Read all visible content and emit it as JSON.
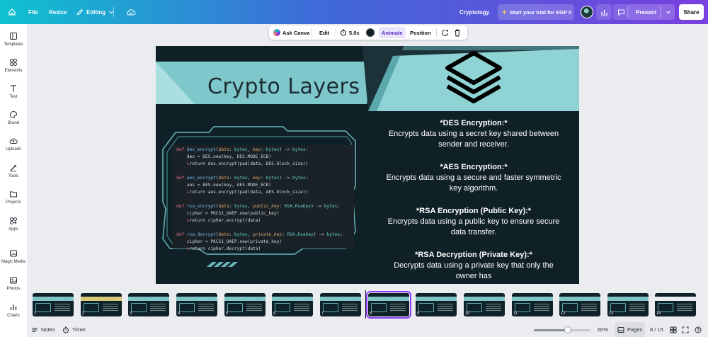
{
  "topbar": {
    "file": "File",
    "resize": "Resize",
    "editing": "Editing",
    "title": "Cryptology",
    "trial": "Start your trial for EGP 0",
    "present": "Present",
    "share": "Share"
  },
  "sidebar": {
    "items": [
      {
        "label": "Templates",
        "icon": "templates-icon"
      },
      {
        "label": "Elements",
        "icon": "elements-icon"
      },
      {
        "label": "Text",
        "icon": "text-icon"
      },
      {
        "label": "Brand",
        "icon": "brand-icon"
      },
      {
        "label": "Uploads",
        "icon": "uploads-icon"
      },
      {
        "label": "Tools",
        "icon": "tools-icon"
      },
      {
        "label": "Projects",
        "icon": "projects-icon"
      },
      {
        "label": "Apps",
        "icon": "apps-icon"
      },
      {
        "label": "Magic Media",
        "icon": "magic-media-icon"
      },
      {
        "label": "Photos",
        "icon": "photos-icon"
      },
      {
        "label": "Charts",
        "icon": "charts-icon"
      }
    ]
  },
  "context_toolbar": {
    "ask_canva": "Ask Canva",
    "edit": "Edit",
    "duration": "5.0s",
    "animate": "Animate",
    "position": "Position"
  },
  "slide": {
    "title": "Crypto Layers",
    "code": [
      {
        "name": "des_encrypt",
        "key_type": "bytes",
        "line2": "des = DES.new(key, DES.MODE_ECB)",
        "line3": "return des.encrypt(pad(data, DES.block_size))",
        "key_param": "key"
      },
      {
        "name": "aes_encrypt",
        "key_type": "bytes",
        "line2": "aes = AES.new(key, AES.MODE_ECB)",
        "line3": "return aes.encrypt(pad(data, AES.block_size))",
        "key_param": "key"
      },
      {
        "name": "rsa_encrypt",
        "key_type": "RSA.RsaKey",
        "line2": "cipher = PKCS1_OAEP.new(public_key)",
        "line3": "return cipher.encrypt(data)",
        "key_param": "public_key"
      },
      {
        "name": "rsa_decrypt",
        "key_type": "RSA.RsaKey",
        "line2": "cipher = PKCS1_OAEP.new(private_key)",
        "line3": "return cipher.decrypt(data)",
        "key_param": "private_key"
      }
    ],
    "sections": [
      {
        "heading": "*DES Encryption:*",
        "body1": "Encrypts data using a secret key shared between",
        "body2": "sender and receiver."
      },
      {
        "heading": "*AES Encryption:*",
        "body1": "Encrypts data using a secure and faster symmetric",
        "body2": "key algorithm."
      },
      {
        "heading": "*RSA Encryption (Public Key):*",
        "body1": "Encrypts data using a public key to ensure secure",
        "body2": "data transfer."
      },
      {
        "heading": "*RSA Decryption (Private Key):*",
        "body1": "Decrypts data using a private key that only the",
        "body2": "owner has"
      }
    ]
  },
  "pages": {
    "thumbnails": [
      "1",
      "2",
      "3",
      "4",
      "5",
      "6",
      "7",
      "8",
      "9",
      "10",
      "11",
      "12",
      "13",
      "14"
    ],
    "active": 8
  },
  "bottombar": {
    "notes": "Notes",
    "timer": "Timer",
    "zoom": "60%",
    "zoom_fraction": 0.6,
    "pages_label": "Pages",
    "page_count": "8 / 15"
  },
  "colors": {
    "accent": "#8b3dff",
    "slide_bg": "#102027",
    "slide_band": "#7fc4c7"
  }
}
